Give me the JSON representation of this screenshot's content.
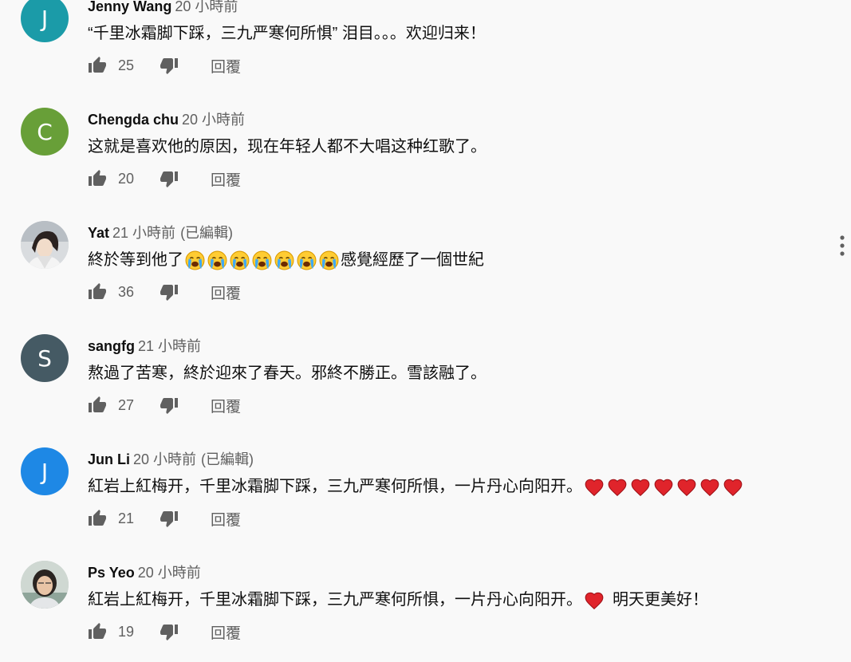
{
  "reply_label": "回覆",
  "edited_label": "(已編輯)",
  "more_icon": "more-vertical-icon",
  "colors": {
    "author": "#0f0f0f",
    "meta": "#606060",
    "heart": "#e0242b",
    "avatar_jenny": "#1b9ba8",
    "avatar_chengda": "#689f38",
    "avatar_sangfg": "#455a64",
    "avatar_junli": "#1e88e5"
  },
  "comments": [
    {
      "author": "Jenny Wang",
      "time": "20 小時前",
      "avatar_letter": "J",
      "text": "“千里冰霜脚下踩，三九严寒何所惧” 泪目。。。欢迎归来！",
      "likes": "25"
    },
    {
      "author": "Chengda chu",
      "time": "20 小時前",
      "avatar_letter": "C",
      "text": "这就是喜欢他的原因，现在年轻人都不大唱这种红歌了。",
      "likes": "20"
    },
    {
      "author": "Yat",
      "time": "21 小時前",
      "text_before": "終於等到他了",
      "emoji": "crying-face-emoji",
      "emoji_count": 7,
      "text_after": "感覺經歷了一個世紀",
      "likes": "36"
    },
    {
      "author": "sangfg",
      "time": "21 小時前",
      "avatar_letter": "S",
      "text": "熬過了苦寒，終於迎來了春天。邪終不勝正。雪該融了。",
      "likes": "27"
    },
    {
      "author": "Jun Li",
      "time": "20 小時前",
      "avatar_letter": "J",
      "text_before": "紅岩上紅梅开，千里冰霜脚下踩，三九严寒何所惧，一片丹心向阳开。",
      "emoji": "red-heart-emoji",
      "emoji_count": 7,
      "likes": "21"
    },
    {
      "author": "Ps Yeo",
      "time": "20 小時前",
      "text_before": "紅岩上紅梅开，千里冰霜脚下踩，三九严寒何所惧，一片丹心向阳开。",
      "emoji": "red-heart-emoji",
      "emoji_count": 1,
      "text_after": "明天更美好！",
      "likes": "19"
    }
  ]
}
